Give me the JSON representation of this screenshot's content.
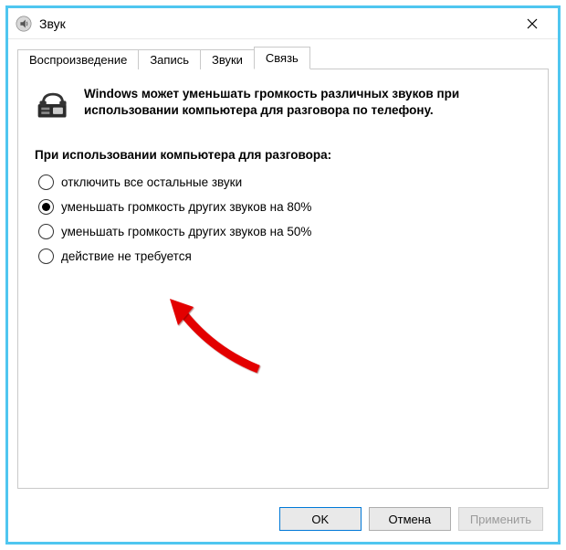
{
  "window": {
    "title": "Звук"
  },
  "tabs": [
    {
      "label": "Воспроизведение"
    },
    {
      "label": "Запись"
    },
    {
      "label": "Звуки"
    },
    {
      "label": "Связь"
    }
  ],
  "active_tab_index": 3,
  "intro_text": "Windows может уменьшать громкость различных звуков при использовании компьютера для разговора по телефону.",
  "group_label": "При использовании компьютера для разговора:",
  "options": [
    {
      "label": "отключить все остальные звуки",
      "checked": false
    },
    {
      "label": "уменьшать громкость других звуков на 80%",
      "checked": true
    },
    {
      "label": "уменьшать громкость других звуков на 50%",
      "checked": false
    },
    {
      "label": "действие не требуется",
      "checked": false
    }
  ],
  "buttons": {
    "ok": "OK",
    "cancel": "Отмена",
    "apply": "Применить"
  }
}
